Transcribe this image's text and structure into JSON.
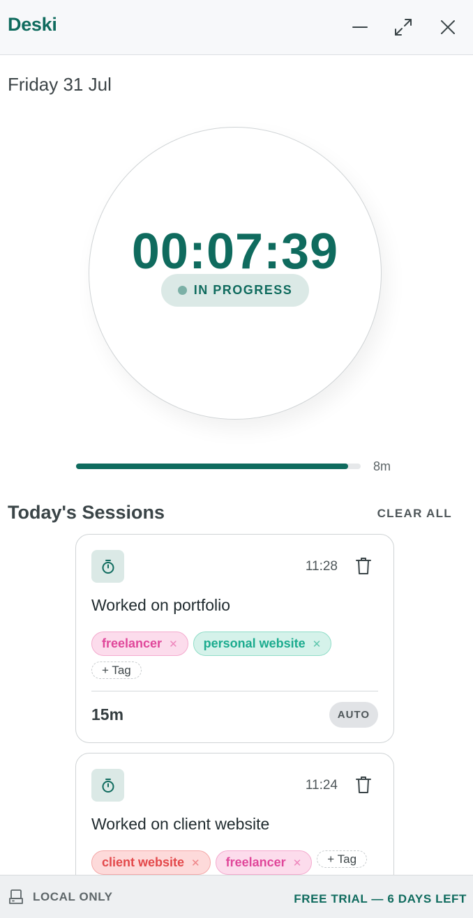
{
  "app": {
    "title": "Deski",
    "window_controls": [
      "minimize-icon",
      "maximize-icon",
      "close-icon"
    ]
  },
  "date": "Friday 31 Jul",
  "timer": {
    "value": "00:07:39",
    "status": "IN PROGRESS",
    "progress": 0.955,
    "progress_label": "8m"
  },
  "sessions": {
    "title": "Today's Sessions",
    "clear_all": "CLEAR ALL",
    "items": [
      {
        "icon": "stopwatch-icon",
        "time": "11:28",
        "title": "Worked on portfolio",
        "tags": [
          {
            "label": "freelancer",
            "color": "#e0479a"
          },
          {
            "label": "personal website",
            "color": "#1bab8e"
          }
        ],
        "add_tag": "+ Tag",
        "duration": "15m",
        "badge": "AUTO"
      },
      {
        "icon": "stopwatch-icon",
        "time": "11:24",
        "title": "Worked on client website",
        "tags": [
          {
            "label": "client website",
            "color": "#e3484a"
          },
          {
            "label": "freelancer",
            "color": "#e0479a"
          }
        ],
        "add_tag": "+ Tag"
      }
    ]
  },
  "footer": {
    "storage_icon": "local-storage-icon",
    "storage": "LOCAL ONLY",
    "trial": "FREE TRIAL — 6 DAYS LEFT"
  },
  "colors": {
    "accent": "#0f6b5e",
    "accent_soft": "#dbe9e6"
  }
}
